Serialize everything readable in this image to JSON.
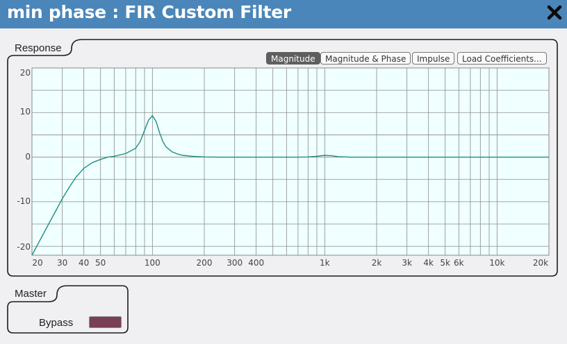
{
  "window": {
    "title": "min phase : FIR Custom Filter"
  },
  "response_group": {
    "label": "Response",
    "buttons": [
      {
        "label": "Magnitude",
        "active": true
      },
      {
        "label": "Magnitude & Phase",
        "active": false
      },
      {
        "label": "Impulse",
        "active": false
      },
      {
        "label": "Load Coefficients...",
        "active": false
      }
    ]
  },
  "master_group": {
    "label": "Master",
    "bypass_label": "Bypass"
  },
  "colors": {
    "titlebar": "#4a86b9",
    "plot_background": "#f0ffff",
    "curve": "#1b8e86",
    "grid": "#8a8a8a",
    "active_button": "#5e5e5e",
    "bypass_button": "#7a3f54"
  },
  "chart_data": {
    "type": "line",
    "x_scale": "log",
    "xlim": [
      20,
      20000
    ],
    "ylim": [
      -22,
      20
    ],
    "x_ticks": [
      {
        "value": 20,
        "label": "20"
      },
      {
        "value": 30,
        "label": "30"
      },
      {
        "value": 40,
        "label": "40"
      },
      {
        "value": 50,
        "label": "50"
      },
      {
        "value": 100,
        "label": "100"
      },
      {
        "value": 200,
        "label": "200"
      },
      {
        "value": 300,
        "label": "300"
      },
      {
        "value": 400,
        "label": "400"
      },
      {
        "value": 1000,
        "label": "1k"
      },
      {
        "value": 2000,
        "label": "2k"
      },
      {
        "value": 3000,
        "label": "3k"
      },
      {
        "value": 4000,
        "label": "4k"
      },
      {
        "value": 5000,
        "label": "5k"
      },
      {
        "value": 6000,
        "label": "6k"
      },
      {
        "value": 10000,
        "label": "10k"
      },
      {
        "value": 20000,
        "label": "20k"
      }
    ],
    "y_ticks": [
      {
        "value": 20,
        "label": "20"
      },
      {
        "value": 10,
        "label": "10"
      },
      {
        "value": 0,
        "label": "0"
      },
      {
        "value": -10,
        "label": "-10"
      },
      {
        "value": -20,
        "label": "-20"
      }
    ],
    "grid": true,
    "series": [
      {
        "x": [
          20,
          22,
          25,
          28,
          30,
          33,
          36,
          40,
          45,
          50,
          55,
          60,
          70,
          80,
          85,
          90,
          95,
          100,
          105,
          110,
          115,
          120,
          130,
          140,
          150,
          170,
          200,
          250,
          300,
          400,
          500,
          700,
          800,
          900,
          1000,
          1100,
          1200,
          1400,
          1600,
          2000,
          3000,
          5000,
          10000,
          20000
        ],
        "y": [
          -22,
          -19,
          -15,
          -11.5,
          -9.3,
          -6.7,
          -4.5,
          -2.5,
          -1.2,
          -0.5,
          0,
          0.2,
          0.8,
          2,
          3.5,
          6,
          8.3,
          9.3,
          8,
          5.5,
          3.5,
          2.3,
          1.2,
          0.7,
          0.4,
          0.2,
          0.05,
          0,
          0,
          0,
          0,
          0,
          0.05,
          0.2,
          0.4,
          0.3,
          0.1,
          0,
          0,
          0,
          0,
          0,
          0,
          0
        ]
      }
    ]
  }
}
